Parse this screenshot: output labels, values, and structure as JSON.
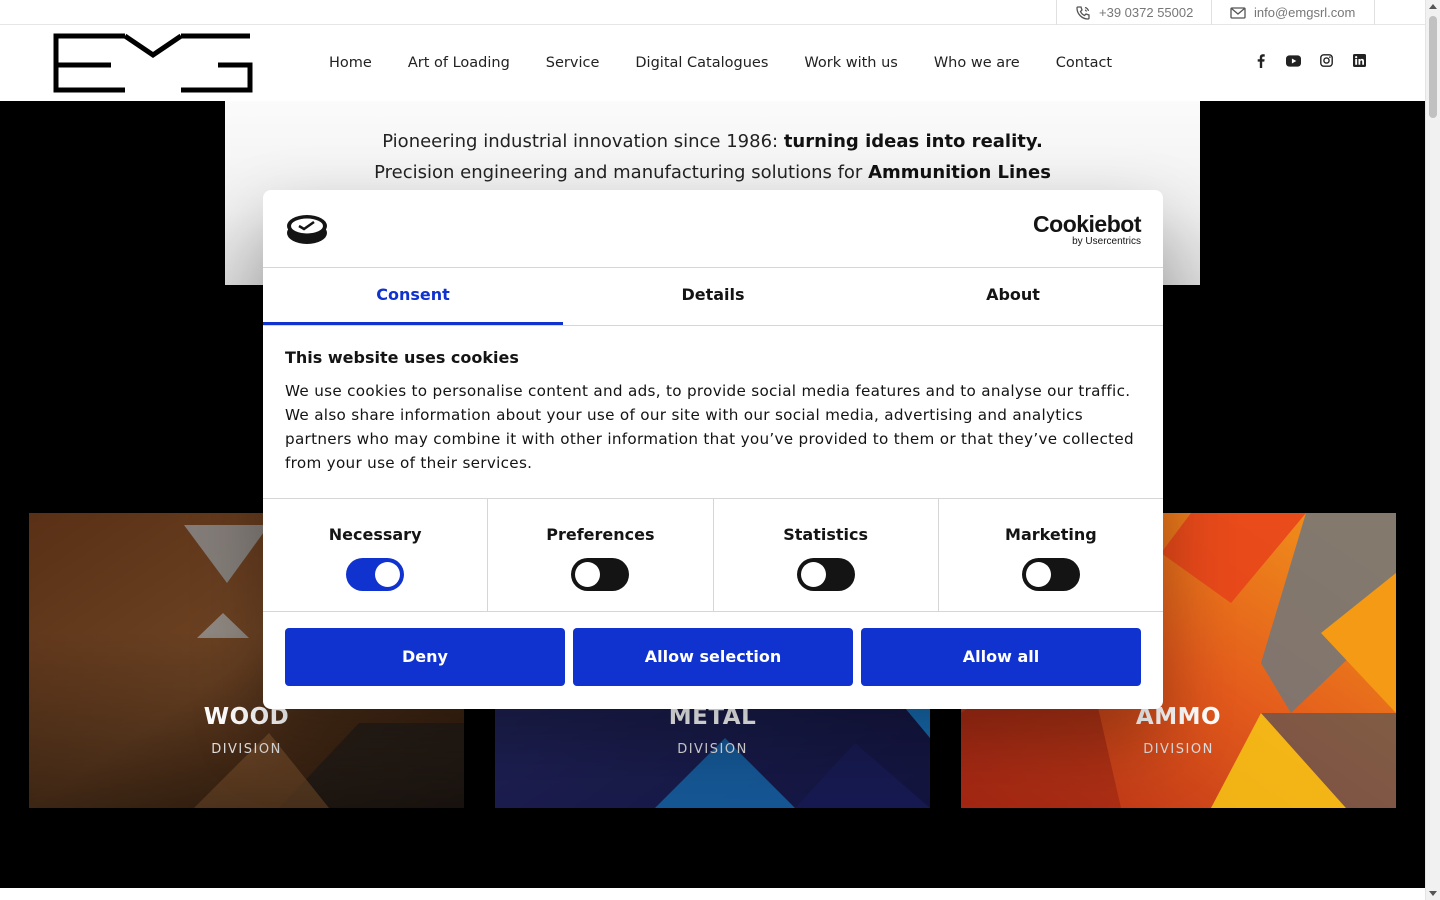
{
  "topbar": {
    "phone": "+39 0372 55002",
    "email": "info@emgsrl.com"
  },
  "header": {
    "logo_text": "EMG",
    "nav": [
      "Home",
      "Art of Loading",
      "Service",
      "Digital Catalogues",
      "Work with us",
      "Who we are",
      "Contact"
    ],
    "social_icons": [
      "facebook-icon",
      "youtube-icon",
      "instagram-icon",
      "linkedin-icon"
    ]
  },
  "hero": {
    "line1_prefix": "Pioneering industrial innovation since 1986: ",
    "line1_bold": "turning ideas into reality.",
    "line2_prefix": "Precision engineering and manufacturing solutions for ",
    "line2_bold": "Ammunition Lines"
  },
  "divisions": [
    {
      "title": "WOOD",
      "subtitle": "DIVISION"
    },
    {
      "title": "METAL",
      "subtitle": "DIVISION"
    },
    {
      "title": "AMMO",
      "subtitle": "DIVISION"
    }
  ],
  "cookie": {
    "brand": "Cookiebot",
    "brand_by": "by Usercentrics",
    "tabs": [
      "Consent",
      "Details",
      "About"
    ],
    "active_tab": "Consent",
    "heading": "This website uses cookies",
    "body": "We use cookies to personalise content and ads, to provide social media features and to analyse our traffic. We also share information about your use of our site with our social media, advertising and analytics partners who may combine it with other information that you’ve provided to them or that they’ve collected from your use of their services.",
    "categories": [
      {
        "label": "Necessary",
        "enabled": true
      },
      {
        "label": "Preferences",
        "enabled": false
      },
      {
        "label": "Statistics",
        "enabled": false
      },
      {
        "label": "Marketing",
        "enabled": false
      }
    ],
    "buttons": [
      "Deny",
      "Allow selection",
      "Allow all"
    ]
  },
  "colors": {
    "accent": "#1032cf",
    "toggle_off": "#141414",
    "wood": "#6b3f22",
    "metal": "#23266a",
    "ammo": "#e2561a"
  }
}
